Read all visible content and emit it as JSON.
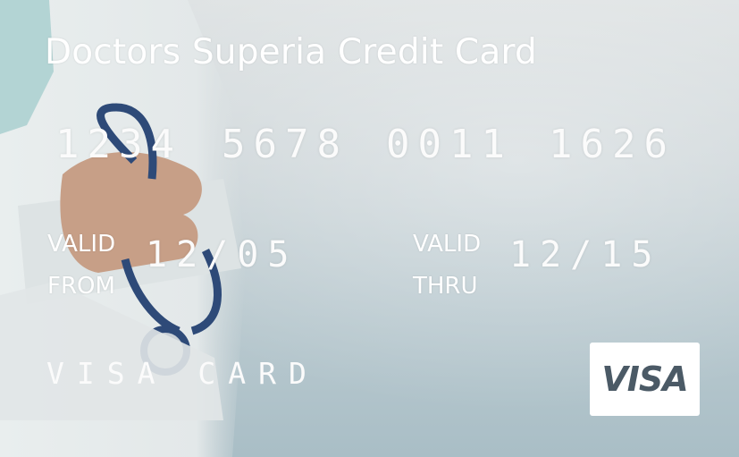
{
  "card": {
    "title": "Doctors Superia Credit Card",
    "number_groups": [
      "1234",
      "5678",
      "0011",
      "1626"
    ],
    "valid_from": {
      "label_line1": "VALID",
      "label_line2": "FROM",
      "date": "12/05"
    },
    "valid_thru": {
      "label_line1": "VALID",
      "label_line2": "THRU",
      "date": "12/15"
    },
    "card_type": "VISA CARD",
    "logo_text": "VISA"
  },
  "colors": {
    "text": "#ffffff",
    "logo_bg": "#ffffff",
    "logo_text": "#4b5a66",
    "coat": "#eef1f1",
    "stethoscope": "#2e4a78"
  },
  "icons": {
    "background_image": "doctor-with-stethoscope",
    "brand": "visa-logo"
  }
}
